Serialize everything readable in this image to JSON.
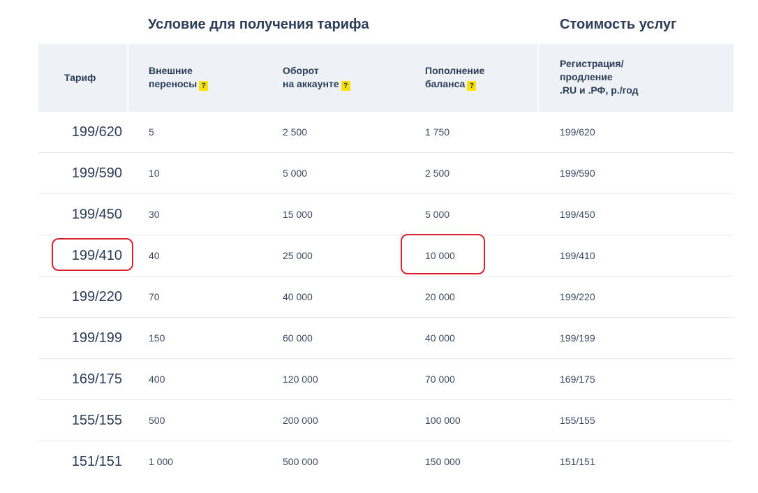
{
  "header": {
    "conditions_title": "Условие для получения тарифа",
    "cost_title": "Стоимость услуг"
  },
  "columns": {
    "tariff": "Тариф",
    "transfers_line1": "Внешние",
    "transfers_line2": "переносы",
    "turnover_line1": "Оборот",
    "turnover_line2": "на аккаунте",
    "topup_line1": "Пополнение",
    "topup_line2": "баланса",
    "price_line1": "Регистрация/",
    "price_line2": "продление",
    "price_line3": ".RU и .РФ, р./год",
    "help_mark": "?"
  },
  "rows": [
    {
      "tariff": "199/620",
      "transfers": "5",
      "turnover": "2 500",
      "topup": "1 750",
      "price": "199/620"
    },
    {
      "tariff": "199/590",
      "transfers": "10",
      "turnover": "5 000",
      "topup": "2 500",
      "price": "199/590"
    },
    {
      "tariff": "199/450",
      "transfers": "30",
      "turnover": "15 000",
      "topup": "5 000",
      "price": "199/450"
    },
    {
      "tariff": "199/410",
      "transfers": "40",
      "turnover": "25 000",
      "topup": "10 000",
      "price": "199/410"
    },
    {
      "tariff": "199/220",
      "transfers": "70",
      "turnover": "40 000",
      "topup": "20 000",
      "price": "199/220"
    },
    {
      "tariff": "199/199",
      "transfers": "150",
      "turnover": "60 000",
      "topup": "40 000",
      "price": "199/199"
    },
    {
      "tariff": "169/175",
      "transfers": "400",
      "turnover": "120 000",
      "topup": "70 000",
      "price": "169/175"
    },
    {
      "tariff": "155/155",
      "transfers": "500",
      "turnover": "200 000",
      "topup": "100 000",
      "price": "155/155"
    },
    {
      "tariff": "151/151",
      "transfers": "1 000",
      "turnover": "500 000",
      "topup": "150 000",
      "price": "151/151"
    }
  ],
  "colors": {
    "highlight": "#d9232e",
    "help_badge": "#ffe100",
    "header_bg": "#eef1f6"
  }
}
